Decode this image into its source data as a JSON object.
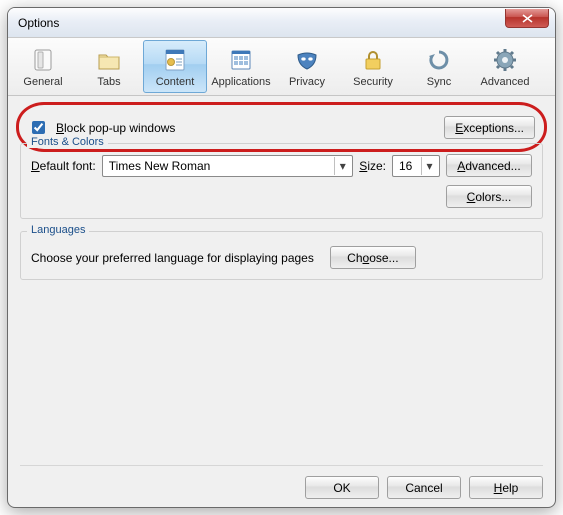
{
  "window": {
    "title": "Options"
  },
  "toolbar": {
    "tabs": [
      {
        "name": "general-tab",
        "label": "General",
        "selected": false
      },
      {
        "name": "tabs-tab",
        "label": "Tabs",
        "selected": false
      },
      {
        "name": "content-tab",
        "label": "Content",
        "selected": true
      },
      {
        "name": "applications-tab",
        "label": "Applications",
        "selected": false
      },
      {
        "name": "privacy-tab",
        "label": "Privacy",
        "selected": false
      },
      {
        "name": "security-tab",
        "label": "Security",
        "selected": false
      },
      {
        "name": "sync-tab",
        "label": "Sync",
        "selected": false
      },
      {
        "name": "advanced-tab",
        "label": "Advanced",
        "selected": false
      }
    ]
  },
  "sections": {
    "popup": {
      "block_popups_checked": true,
      "block_popups_prefix": "B",
      "block_popups_rest": "lock pop-up windows",
      "exceptions_prefix": "E",
      "exceptions_rest": "xceptions..."
    },
    "fonts": {
      "legend": "Fonts & Colors",
      "default_font_prefix": "D",
      "default_font_rest": "efault font:",
      "default_font_value": "Times New Roman",
      "size_prefix": "S",
      "size_rest": "ize:",
      "size_value": "16",
      "advanced_prefix": "A",
      "advanced_rest": "dvanced...",
      "colors_prefix": "C",
      "colors_rest": "olors..."
    },
    "languages": {
      "legend": "Languages",
      "desc": "Choose your preferred language for displaying pages",
      "choose_prefix": "Ch",
      "choose_rest": "oose..."
    }
  },
  "buttons": {
    "ok": "OK",
    "cancel": "Cancel",
    "help_prefix": "H",
    "help_rest": "elp"
  }
}
